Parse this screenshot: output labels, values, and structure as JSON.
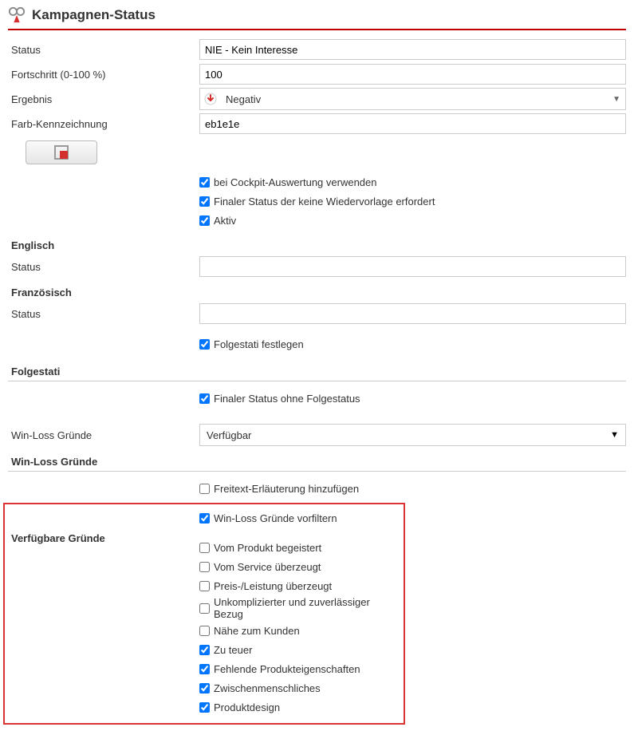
{
  "header": {
    "title": "Kampagnen-Status"
  },
  "fields": {
    "status_label": "Status",
    "status_value": "NIE - Kein Interesse",
    "fortschritt_label": "Fortschritt (0-100 %)",
    "fortschritt_value": "100",
    "ergebnis_label": "Ergebnis",
    "ergebnis_value": "Negativ",
    "farb_label": "Farb-Kennzeichnung",
    "farb_value": "eb1e1e"
  },
  "checkboxes1": {
    "cockpit": "bei Cockpit-Auswertung verwenden",
    "finaler_wv": "Finaler Status der keine Wiedervorlage erfordert",
    "aktiv": "Aktiv"
  },
  "englisch": {
    "heading": "Englisch",
    "status_label": "Status",
    "status_value": ""
  },
  "franzoesisch": {
    "heading": "Französisch",
    "status_label": "Status",
    "status_value": ""
  },
  "folgestati": {
    "festlegen_label": "Folgestati festlegen",
    "heading": "Folgestati",
    "finaler_ohne_label": "Finaler Status ohne Folgestatus"
  },
  "winloss": {
    "gruende_label": "Win-Loss Gründe",
    "select_value": "Verfügbar",
    "heading": "Win-Loss Gründe",
    "freitext_label": "Freitext-Erläuterung hinzufügen",
    "vorfiltern_label": "Win-Loss Gründe vorfiltern"
  },
  "verfuegbare": {
    "heading": "Verfügbare Gründe",
    "items": [
      {
        "label": "Vom Produkt begeistert",
        "checked": false
      },
      {
        "label": "Vom Service überzeugt",
        "checked": false
      },
      {
        "label": "Preis-/Leistung überzeugt",
        "checked": false
      },
      {
        "label": "Unkomplizierter und zuverlässiger Bezug",
        "checked": false
      },
      {
        "label": "Nähe zum Kunden",
        "checked": false
      },
      {
        "label": "Zu teuer",
        "checked": true
      },
      {
        "label": "Fehlende Produkteigenschaften",
        "checked": true
      },
      {
        "label": "Zwischenmenschliches",
        "checked": true
      },
      {
        "label": "Produktdesign",
        "checked": true
      }
    ]
  }
}
